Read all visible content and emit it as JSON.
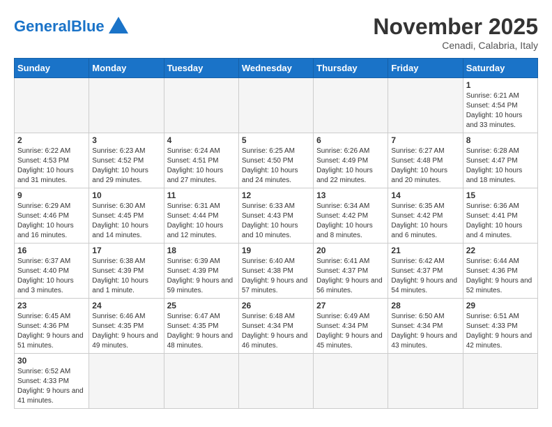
{
  "logo": {
    "text_general": "General",
    "text_blue": "Blue"
  },
  "title": "November 2025",
  "subtitle": "Cenadi, Calabria, Italy",
  "days_of_week": [
    "Sunday",
    "Monday",
    "Tuesday",
    "Wednesday",
    "Thursday",
    "Friday",
    "Saturday"
  ],
  "weeks": [
    [
      {
        "day": "",
        "info": ""
      },
      {
        "day": "",
        "info": ""
      },
      {
        "day": "",
        "info": ""
      },
      {
        "day": "",
        "info": ""
      },
      {
        "day": "",
        "info": ""
      },
      {
        "day": "",
        "info": ""
      },
      {
        "day": "1",
        "info": "Sunrise: 6:21 AM\nSunset: 4:54 PM\nDaylight: 10 hours and 33 minutes."
      }
    ],
    [
      {
        "day": "2",
        "info": "Sunrise: 6:22 AM\nSunset: 4:53 PM\nDaylight: 10 hours and 31 minutes."
      },
      {
        "day": "3",
        "info": "Sunrise: 6:23 AM\nSunset: 4:52 PM\nDaylight: 10 hours and 29 minutes."
      },
      {
        "day": "4",
        "info": "Sunrise: 6:24 AM\nSunset: 4:51 PM\nDaylight: 10 hours and 27 minutes."
      },
      {
        "day": "5",
        "info": "Sunrise: 6:25 AM\nSunset: 4:50 PM\nDaylight: 10 hours and 24 minutes."
      },
      {
        "day": "6",
        "info": "Sunrise: 6:26 AM\nSunset: 4:49 PM\nDaylight: 10 hours and 22 minutes."
      },
      {
        "day": "7",
        "info": "Sunrise: 6:27 AM\nSunset: 4:48 PM\nDaylight: 10 hours and 20 minutes."
      },
      {
        "day": "8",
        "info": "Sunrise: 6:28 AM\nSunset: 4:47 PM\nDaylight: 10 hours and 18 minutes."
      }
    ],
    [
      {
        "day": "9",
        "info": "Sunrise: 6:29 AM\nSunset: 4:46 PM\nDaylight: 10 hours and 16 minutes."
      },
      {
        "day": "10",
        "info": "Sunrise: 6:30 AM\nSunset: 4:45 PM\nDaylight: 10 hours and 14 minutes."
      },
      {
        "day": "11",
        "info": "Sunrise: 6:31 AM\nSunset: 4:44 PM\nDaylight: 10 hours and 12 minutes."
      },
      {
        "day": "12",
        "info": "Sunrise: 6:33 AM\nSunset: 4:43 PM\nDaylight: 10 hours and 10 minutes."
      },
      {
        "day": "13",
        "info": "Sunrise: 6:34 AM\nSunset: 4:42 PM\nDaylight: 10 hours and 8 minutes."
      },
      {
        "day": "14",
        "info": "Sunrise: 6:35 AM\nSunset: 4:42 PM\nDaylight: 10 hours and 6 minutes."
      },
      {
        "day": "15",
        "info": "Sunrise: 6:36 AM\nSunset: 4:41 PM\nDaylight: 10 hours and 4 minutes."
      }
    ],
    [
      {
        "day": "16",
        "info": "Sunrise: 6:37 AM\nSunset: 4:40 PM\nDaylight: 10 hours and 3 minutes."
      },
      {
        "day": "17",
        "info": "Sunrise: 6:38 AM\nSunset: 4:39 PM\nDaylight: 10 hours and 1 minute."
      },
      {
        "day": "18",
        "info": "Sunrise: 6:39 AM\nSunset: 4:39 PM\nDaylight: 9 hours and 59 minutes."
      },
      {
        "day": "19",
        "info": "Sunrise: 6:40 AM\nSunset: 4:38 PM\nDaylight: 9 hours and 57 minutes."
      },
      {
        "day": "20",
        "info": "Sunrise: 6:41 AM\nSunset: 4:37 PM\nDaylight: 9 hours and 56 minutes."
      },
      {
        "day": "21",
        "info": "Sunrise: 6:42 AM\nSunset: 4:37 PM\nDaylight: 9 hours and 54 minutes."
      },
      {
        "day": "22",
        "info": "Sunrise: 6:44 AM\nSunset: 4:36 PM\nDaylight: 9 hours and 52 minutes."
      }
    ],
    [
      {
        "day": "23",
        "info": "Sunrise: 6:45 AM\nSunset: 4:36 PM\nDaylight: 9 hours and 51 minutes."
      },
      {
        "day": "24",
        "info": "Sunrise: 6:46 AM\nSunset: 4:35 PM\nDaylight: 9 hours and 49 minutes."
      },
      {
        "day": "25",
        "info": "Sunrise: 6:47 AM\nSunset: 4:35 PM\nDaylight: 9 hours and 48 minutes."
      },
      {
        "day": "26",
        "info": "Sunrise: 6:48 AM\nSunset: 4:34 PM\nDaylight: 9 hours and 46 minutes."
      },
      {
        "day": "27",
        "info": "Sunrise: 6:49 AM\nSunset: 4:34 PM\nDaylight: 9 hours and 45 minutes."
      },
      {
        "day": "28",
        "info": "Sunrise: 6:50 AM\nSunset: 4:34 PM\nDaylight: 9 hours and 43 minutes."
      },
      {
        "day": "29",
        "info": "Sunrise: 6:51 AM\nSunset: 4:33 PM\nDaylight: 9 hours and 42 minutes."
      }
    ],
    [
      {
        "day": "30",
        "info": "Sunrise: 6:52 AM\nSunset: 4:33 PM\nDaylight: 9 hours and 41 minutes."
      },
      {
        "day": "",
        "info": ""
      },
      {
        "day": "",
        "info": ""
      },
      {
        "day": "",
        "info": ""
      },
      {
        "day": "",
        "info": ""
      },
      {
        "day": "",
        "info": ""
      },
      {
        "day": "",
        "info": ""
      }
    ]
  ]
}
